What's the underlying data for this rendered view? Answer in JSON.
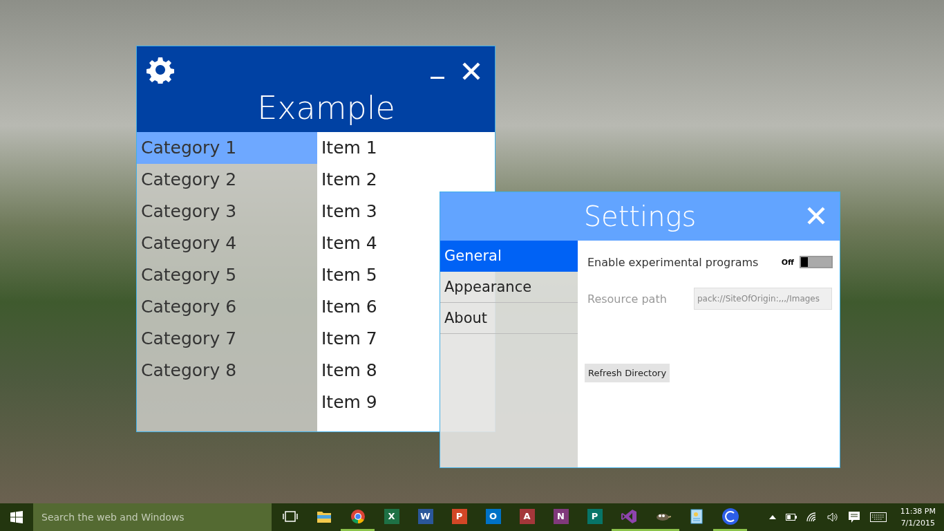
{
  "example_window": {
    "title": "Example",
    "categories": [
      {
        "label": "Category 1",
        "selected": true
      },
      {
        "label": "Category 2",
        "selected": false
      },
      {
        "label": "Category 3",
        "selected": false
      },
      {
        "label": "Category 4",
        "selected": false
      },
      {
        "label": "Category 5",
        "selected": false
      },
      {
        "label": "Category 6",
        "selected": false
      },
      {
        "label": "Category 7",
        "selected": false
      },
      {
        "label": "Category 8",
        "selected": false
      }
    ],
    "items": [
      "Item 1",
      "Item 2",
      "Item 3",
      "Item 4",
      "Item 5",
      "Item 6",
      "Item 7",
      "Item 8",
      "Item 9"
    ]
  },
  "settings_window": {
    "title": "Settings",
    "nav": [
      {
        "label": "General",
        "selected": true
      },
      {
        "label": "Appearance",
        "selected": false
      },
      {
        "label": "About",
        "selected": false
      }
    ],
    "toggle": {
      "label": "Enable experimental programs",
      "state_text": "Off",
      "on": false
    },
    "resource_path": {
      "label": "Resource path",
      "value": "pack://SiteOfOrigin:,,,/Images",
      "disabled": true
    },
    "button": "Refresh Directory"
  },
  "taskbar": {
    "search": {
      "placeholder": "Search the web and Windows"
    },
    "apps": [
      {
        "kind": "task-view",
        "running": false
      },
      {
        "kind": "folder",
        "running": false
      },
      {
        "kind": "chrome",
        "running": true
      },
      {
        "kind": "office",
        "letter": "X",
        "color": "#1e7145",
        "running": false
      },
      {
        "kind": "office",
        "letter": "W",
        "color": "#2b579a",
        "running": false
      },
      {
        "kind": "office",
        "letter": "P",
        "color": "#d24726",
        "running": false
      },
      {
        "kind": "office",
        "letter": "O",
        "color": "#0072c6",
        "running": false
      },
      {
        "kind": "office",
        "letter": "A",
        "color": "#a4373a",
        "running": false
      },
      {
        "kind": "office",
        "letter": "N",
        "color": "#80397b",
        "running": false
      },
      {
        "kind": "office",
        "letter": "P",
        "color": "#077568",
        "running": false
      },
      {
        "kind": "visual-studio",
        "running": true
      },
      {
        "kind": "gimp",
        "running": true
      },
      {
        "kind": "document",
        "running": false
      },
      {
        "kind": "circle-app",
        "running": true
      }
    ],
    "time": "11:38 PM",
    "date": "7/1/2015"
  }
}
